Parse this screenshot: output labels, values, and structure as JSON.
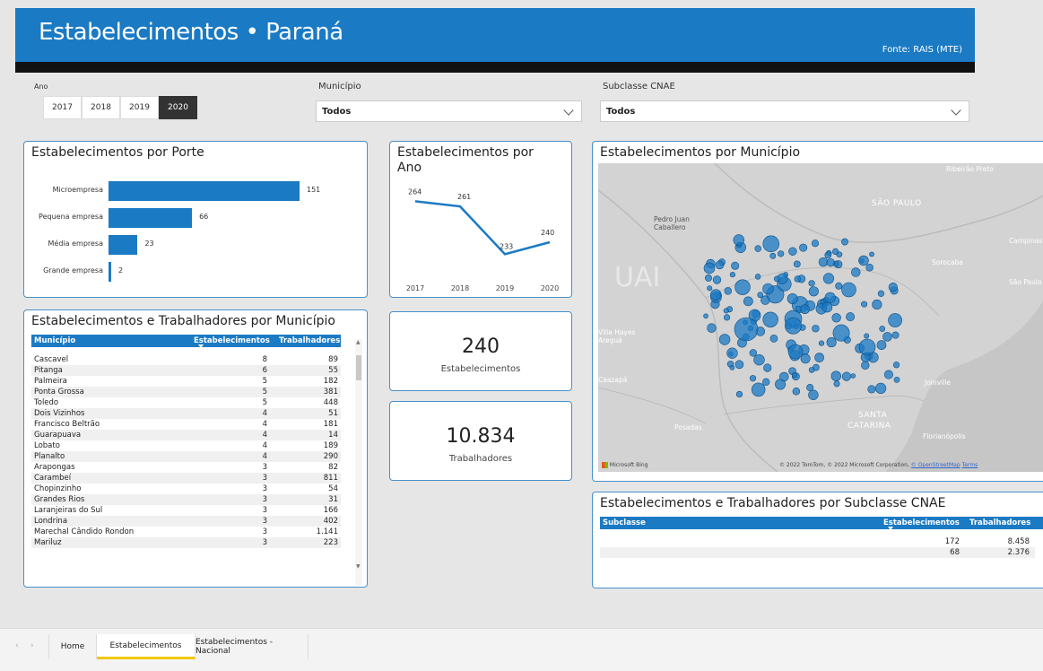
{
  "header": {
    "title_main": "Estabelecimentos",
    "title_sep": "•",
    "title_region": "Paraná",
    "source": "Fonte: RAIS (MTE)"
  },
  "filters": {
    "year_label": "Ano",
    "years": [
      "2017",
      "2018",
      "2019",
      "2020"
    ],
    "selected_year": "2020",
    "municipio_label": "Município",
    "municipio_value": "Todos",
    "cnae_label": "Subclasse CNAE",
    "cnae_value": "Todos"
  },
  "porte": {
    "title": "Estabelecimentos por Porte",
    "chart_data": {
      "type": "bar",
      "orientation": "horizontal",
      "categories": [
        "Microempresa",
        "Pequena empresa",
        "Média empresa",
        "Grande empresa"
      ],
      "values": [
        151,
        66,
        23,
        2
      ],
      "title": "Estabelecimentos por Porte"
    }
  },
  "ano": {
    "title_line1": "Estabelecimentos por",
    "title_line2": "Ano",
    "chart_data": {
      "type": "line",
      "x": [
        "2017",
        "2018",
        "2019",
        "2020"
      ],
      "values": [
        264,
        261,
        233,
        240
      ],
      "title": "Estabelecimentos por Ano"
    }
  },
  "kpi_estab": {
    "value": "240",
    "label": "Estabelecimentos"
  },
  "kpi_trab": {
    "value": "10.834",
    "label": "Trabalhadores"
  },
  "municipio_table": {
    "title": "Estabelecimentos e Trabalhadores por Município",
    "columns": [
      "Município",
      "Estabelecimentos",
      "Trabalhadores"
    ],
    "rows": [
      [
        "Cascavel",
        "8",
        "89"
      ],
      [
        "Pitanga",
        "6",
        "55"
      ],
      [
        "Palmeira",
        "5",
        "182"
      ],
      [
        "Ponta Grossa",
        "5",
        "381"
      ],
      [
        "Toledo",
        "5",
        "448"
      ],
      [
        "Dois Vizinhos",
        "4",
        "51"
      ],
      [
        "Francisco Beltrão",
        "4",
        "181"
      ],
      [
        "Guarapuava",
        "4",
        "14"
      ],
      [
        "Lobato",
        "4",
        "189"
      ],
      [
        "Planalto",
        "4",
        "290"
      ],
      [
        "Arapongas",
        "3",
        "82"
      ],
      [
        "Carambeí",
        "3",
        "811"
      ],
      [
        "Chopinzinho",
        "3",
        "54"
      ],
      [
        "Grandes Rios",
        "3",
        "31"
      ],
      [
        "Laranjeiras do Sul",
        "3",
        "166"
      ],
      [
        "Londrina",
        "3",
        "402"
      ],
      [
        "Marechal Cândido Rondon",
        "3",
        "1.141"
      ],
      [
        "Mariluz",
        "3",
        "223"
      ]
    ]
  },
  "map": {
    "title": "Estabelecimentos por Município",
    "labels": {
      "ribeirao": "Ribeirão Preto",
      "saopaulo_state": "SÃO PAULO",
      "pedro": "Pedro Juan",
      "caballero": "Caballero",
      "campinas": "Campinas",
      "sorocaba": "Sorocaba",
      "saopaulo_city": "São Paulo",
      "villa1": "Villa Hayes",
      "villa2": "Areguá",
      "caazapa": "Caazapá",
      "joinville": "Joinville",
      "posadas": "Posadas",
      "sc1": "SANTA",
      "sc2": "CATARINA",
      "floripa": "Florianópolis",
      "uai": "UAI",
      "bing": "Microsoft Bing",
      "copyright": "© 2022 TomTom, © 2022 Microsoft Corporation",
      "osm": "© OpenStreetMap",
      "terms": "Terms"
    }
  },
  "cnae_table": {
    "title": "Estabelecimentos e Trabalhadores por Subclasse CNAE",
    "columns": [
      "Subclasse",
      "Estabelecimentos",
      "Trabalhadores"
    ],
    "rows": [
      [
        "",
        "172",
        "8.458"
      ],
      [
        "",
        "68",
        "2.376"
      ]
    ]
  },
  "tabs": {
    "items": [
      "Home",
      "Estabelecimentos",
      "Estabelecimentos - Nacional"
    ],
    "active": "Estabelecimentos"
  },
  "colors": {
    "primary": "#1b7ac4",
    "header_bar": "#111111",
    "tab_active": "#f2c811"
  }
}
